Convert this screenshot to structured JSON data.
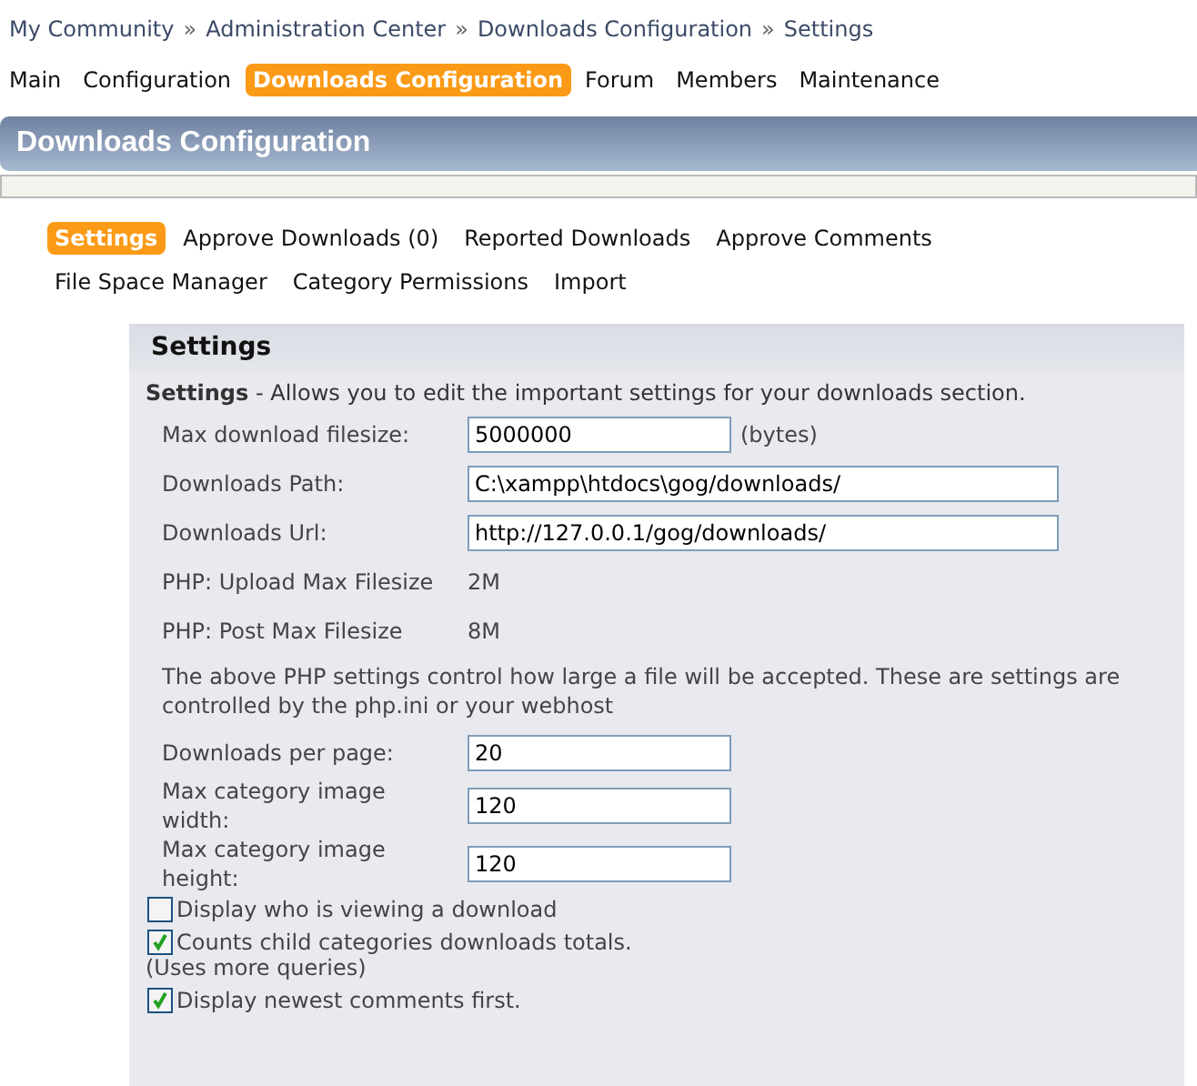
{
  "breadcrumb": [
    "My Community",
    "Administration Center",
    "Downloads Configuration",
    "Settings"
  ],
  "breadcrumb_separator": "»",
  "main_nav": [
    {
      "label": "Main",
      "selected": false
    },
    {
      "label": "Configuration",
      "selected": false
    },
    {
      "label": "Downloads Configuration",
      "selected": true
    },
    {
      "label": "Forum",
      "selected": false
    },
    {
      "label": "Members",
      "selected": false
    },
    {
      "label": "Maintenance",
      "selected": false
    }
  ],
  "page_header": {
    "title": "Downloads Configuration"
  },
  "sub_nav": [
    {
      "label": "Settings",
      "selected": true
    },
    {
      "label": "Approve Downloads (0)",
      "selected": false
    },
    {
      "label": "Reported Downloads",
      "selected": false
    },
    {
      "label": "Approve Comments",
      "selected": false
    },
    {
      "label": "File Space Manager",
      "selected": false
    },
    {
      "label": "Category Permissions",
      "selected": false
    },
    {
      "label": "Import",
      "selected": false
    }
  ],
  "panel": {
    "title": "Settings",
    "intro_label": "Settings",
    "intro_text": "- Allows you to edit the important settings for your downloads section.",
    "rows": [
      {
        "kind": "short_input",
        "label": "Max download filesize:",
        "value": "5000000",
        "suffix": "(bytes)"
      },
      {
        "kind": "long_input",
        "label": "Downloads Path:",
        "value": "C:\\xampp\\htdocs\\gog/downloads/"
      },
      {
        "kind": "long_input",
        "label": "Downloads Url:",
        "value": "http://127.0.0.1/gog/downloads/"
      },
      {
        "kind": "value",
        "label": "PHP: Upload Max Filesize",
        "value": "2M"
      },
      {
        "kind": "value",
        "label": "PHP: Post Max Filesize",
        "value": "8M"
      },
      {
        "kind": "note",
        "text": "The above PHP settings control how large a file will be accepted. These are settings are controlled by the php.ini or your webhost"
      },
      {
        "kind": "short_input",
        "label": "Downloads per page:",
        "value": "20"
      },
      {
        "kind": "short_input",
        "label": "Max category image width:",
        "value": "120"
      },
      {
        "kind": "short_input",
        "label": "Max category image height:",
        "value": "120"
      },
      {
        "kind": "checkbox",
        "label": "Display who is viewing a download",
        "checked": false
      },
      {
        "kind": "checkbox",
        "label": "Counts child categories downloads totals.",
        "note": "(Uses more queries)",
        "checked": true
      },
      {
        "kind": "checkbox",
        "label": "Display newest comments first.",
        "checked": true
      }
    ]
  }
}
